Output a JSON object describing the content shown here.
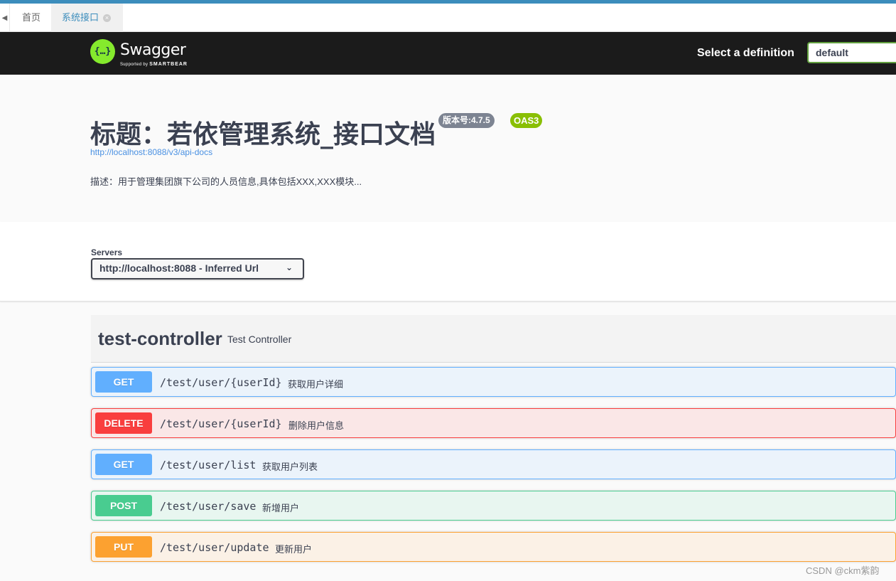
{
  "tabs": {
    "items": [
      {
        "label": "首页"
      },
      {
        "label": "系统接口"
      }
    ],
    "close_glyph": "×"
  },
  "header": {
    "logo_glyph": "{…}",
    "logo_text": "Swagger",
    "logo_sub_prefix": "Supported by",
    "logo_sub_brand": "SMARTBEAR",
    "select_label": "Select a definition",
    "select_value": "default"
  },
  "info": {
    "title": "标题：若依管理系统_接口文档",
    "version": "版本号:4.7.5",
    "oas": "OAS3",
    "url": "http://localhost:8088/v3/api-docs",
    "description": "描述：用于管理集团旗下公司的人员信息,具体包括XXX,XXX模块..."
  },
  "servers": {
    "label": "Servers",
    "selected": "http://localhost:8088 - Inferred Url",
    "chevron": "⌄"
  },
  "tag": {
    "name": "test-controller",
    "description": "Test Controller"
  },
  "operations": [
    {
      "method": "GET",
      "path": "/test/user/{userId}",
      "summary": "获取用户详细"
    },
    {
      "method": "DELETE",
      "path": "/test/user/{userId}",
      "summary": "删除用户信息"
    },
    {
      "method": "GET",
      "path": "/test/user/list",
      "summary": "获取用户列表"
    },
    {
      "method": "POST",
      "path": "/test/user/save",
      "summary": "新增用户"
    },
    {
      "method": "PUT",
      "path": "/test/user/update",
      "summary": "更新用户"
    }
  ],
  "colors": {
    "get": "#61affe",
    "delete": "#f93e3e",
    "post": "#49cc90",
    "put": "#fca130",
    "swagger_green": "#85ea2d"
  },
  "watermark": "CSDN @ckm紫韵"
}
